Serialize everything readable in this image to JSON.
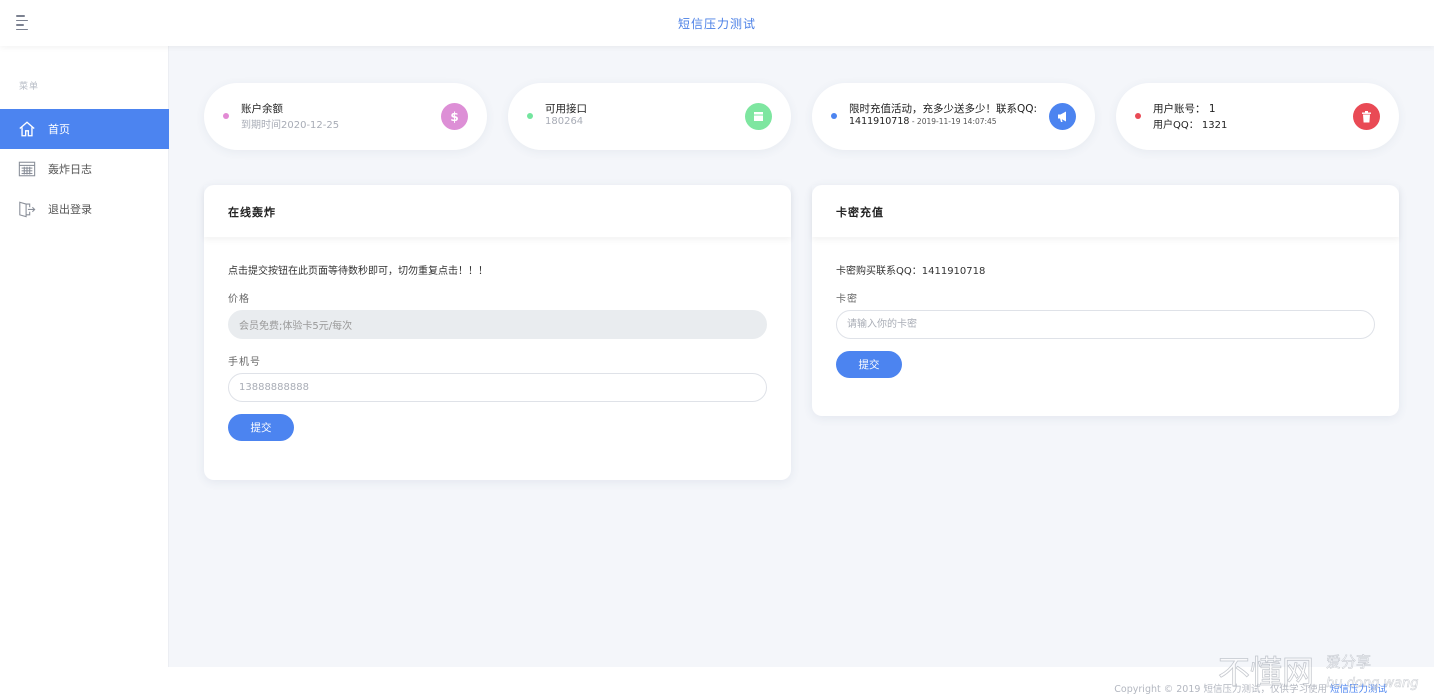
{
  "app": {
    "title": "短信压力测试"
  },
  "sidebar": {
    "caption": "菜单",
    "items": [
      {
        "label": "首页",
        "icon": "home-icon",
        "active": true
      },
      {
        "label": "轰炸日志",
        "icon": "calendar-icon",
        "active": false
      },
      {
        "label": "退出登录",
        "icon": "logout-icon",
        "active": false
      }
    ]
  },
  "stats": [
    {
      "line1": "账户余额",
      "line2": "到期时间2020-12-25",
      "icon": "dollar-icon",
      "dot_color": "#e28ad4",
      "badge_color": "#dd8fd6"
    },
    {
      "line1": "可用接口",
      "line2": "180264",
      "icon": "square-icon",
      "dot_color": "#73e59e",
      "badge_color": "#7ee6a0"
    },
    {
      "line1": "限时充值活动，充多少送多少！联系QQ:",
      "line2": "1411910718",
      "line2_small": " - 2019-11-19 14:07:45",
      "icon": "megaphone-icon",
      "dot_color": "#4c84f0",
      "badge_color": "#4c84f0"
    },
    {
      "line1": "用户账号：  1",
      "line2": "用户QQ：  1321",
      "icon": "trash-icon",
      "dot_color": "#e94a55",
      "badge_color": "#e94a55"
    }
  ],
  "bomb_panel": {
    "title": "在线轰炸",
    "notice": "点击提交按钮在此页面等待数秒即可，切勿重复点击！！！",
    "price_label": "价格",
    "price_value": "会员免费;体验卡5元/每次",
    "phone_label": "手机号",
    "phone_placeholder": "13888888888",
    "submit_label": "提交"
  },
  "card_panel": {
    "title": "卡密充值",
    "notice": "卡密购买联系QQ：1411910718",
    "card_label": "卡密",
    "card_placeholder": "请输入你的卡密",
    "submit_label": "提交"
  },
  "footer": {
    "copyright_prefix": "Copyright © 2019 短信压力测试，仅供学习使用 ",
    "copyright_link": "短信压力测试"
  },
  "watermark": {
    "main": "不懂网",
    "sub": "爱分享",
    "latin": "bu dong wang"
  },
  "colors": {
    "accent": "#4c84f0",
    "background": "#f4f6fa"
  }
}
